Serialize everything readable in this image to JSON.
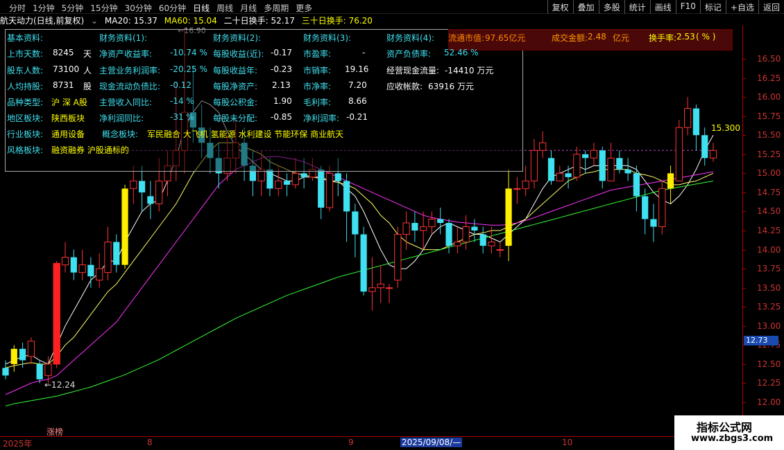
{
  "toolbar": {
    "periods": [
      "分时",
      "1分钟",
      "5分钟",
      "15分钟",
      "30分钟",
      "60分钟",
      "日线",
      "周线",
      "月线",
      "多周期",
      "更多"
    ],
    "right_tools": [
      "复权",
      "叠加",
      "多股",
      "统计",
      "画线",
      "F10",
      "标记",
      "+自选",
      "返回"
    ]
  },
  "infobar": {
    "stock": "航天动力(日线,前复权)",
    "ma20": "MA20: 15.37",
    "ma60": "MA60: 15.04",
    "turn20": "二十日换手: 52.17",
    "turn30": "三十日换手: 76.20",
    "high_note": "←16.90"
  },
  "panel": {
    "col1_header": "基本资料:",
    "col2_header": "财务资料(1):",
    "col3_header": "财务资料(2):",
    "col4_header": "财务资料(3):",
    "col5_header": "财务资料(4):",
    "r1": {
      "l1": "上市天数:",
      "v1": "8245",
      "u1": "天",
      "l2": "净资产收益率:",
      "v2": "-10.74 %",
      "l3": "每股收益(近):",
      "v3": "-0.17",
      "l4": "市盈率:",
      "v4": "-",
      "l5": "资产负债率:",
      "v5": "52.46 %"
    },
    "r2": {
      "l1": "股东人数:",
      "v1": "73100",
      "u1": "人",
      "l2": "主营业务利润率:",
      "v2": "-20.25 %",
      "l3": "每股收益年:",
      "v3": "-0.23",
      "l4": "市销率:",
      "v4": "19.16",
      "l5": "经营现金流量:",
      "v5": "-14410 万元"
    },
    "r3": {
      "l1": "人均持股:",
      "v1": "8731",
      "u1": "股",
      "l2": "现金流动负债比:",
      "v2": "-0.12",
      "l3": "每股净资产:",
      "v3": "2.13",
      "l4": "市净率:",
      "v4": "7.20",
      "l5": "应收帐款:",
      "v5": "63916 万元"
    },
    "r4": {
      "l1": "品种类型:",
      "v1": "沪 深 A股",
      "l2": "主营收入同比:",
      "v2": "-14 %",
      "l3": "每股公积金:",
      "v3": "1.90",
      "l4": "毛利率:",
      "v4": "8.66"
    },
    "r5": {
      "l1": "地区板块:",
      "v1": "陕西板块",
      "l2": "净利润同比:",
      "v2": "-31 %",
      "l3": "每股未分配:",
      "v3": "-0.85",
      "l4": "净利润率:",
      "v4": "-0.21"
    },
    "r6": {
      "l1": "行业板块:",
      "v1": "通用设备",
      "l2": "概念板块:",
      "v2": "军民融合 大飞机 氢能源 水利建设 节能环保 商业航天"
    },
    "r7": {
      "l1": "风格板块:",
      "v1": "融资融券 沪股通标的"
    }
  },
  "market": {
    "float_label": "流通市值:",
    "float_value": "97.65亿元",
    "amount_label": "成交金额:",
    "amount_value": "2.48",
    "amount_unit": "亿元",
    "turnover_label": "换手率:",
    "turnover_value": "2.53",
    "turnover_unit": "( % )"
  },
  "price_axis": {
    "ticks": [
      "16.50",
      "16.25",
      "16.00",
      "15.75",
      "15.50",
      "15.25",
      "15.00",
      "14.75",
      "14.50",
      "14.25",
      "14.00",
      "13.75",
      "13.50",
      "13.25",
      "13.00",
      "12.75",
      "12.50",
      "12.25",
      "12.00"
    ],
    "current": "12.73"
  },
  "annotations": {
    "low": "←12.24",
    "last_high": "15.300",
    "zhangbang": "涨榜"
  },
  "time_axis": {
    "year": "2025年",
    "m8": "8",
    "m9": "9",
    "date": "2025/09/08/—",
    "m10": "10"
  },
  "watermark": {
    "title": "指标公式网",
    "url": "www.zbgs3.com"
  },
  "colors": {
    "up": "#ff3333",
    "down": "#3fe0f0",
    "limit": "#ffee00",
    "ma5": "#ffffff",
    "ma10": "#ffff66",
    "ma20": "#ff33ff",
    "ma60": "#33ff33"
  },
  "chart_data": {
    "type": "candlestick",
    "ylim": [
      11.9,
      16.8
    ],
    "candles": [
      [
        12.45,
        12.35,
        12.55,
        12.3
      ],
      [
        12.5,
        12.7,
        12.75,
        12.4
      ],
      [
        12.7,
        12.55,
        12.78,
        12.45
      ],
      [
        12.6,
        12.8,
        12.85,
        12.5
      ],
      [
        12.5,
        12.3,
        12.55,
        12.25
      ],
      [
        12.35,
        12.5,
        12.6,
        12.24
      ],
      [
        12.5,
        13.82,
        13.85,
        12.45
      ],
      [
        13.8,
        13.9,
        14.1,
        13.7
      ],
      [
        13.9,
        13.7,
        14.0,
        13.6
      ],
      [
        13.7,
        13.8,
        14.0,
        13.6
      ],
      [
        13.8,
        13.65,
        13.9,
        13.5
      ],
      [
        13.6,
        13.75,
        13.95,
        13.5
      ],
      [
        13.7,
        14.1,
        14.3,
        13.6
      ],
      [
        14.1,
        13.8,
        14.2,
        13.7
      ],
      [
        13.8,
        14.8,
        14.85,
        13.75
      ],
      [
        14.8,
        14.9,
        15.1,
        14.6
      ],
      [
        14.9,
        14.75,
        15.1,
        14.5
      ],
      [
        14.7,
        14.6,
        14.9,
        14.4
      ],
      [
        14.6,
        14.9,
        15.2,
        14.5
      ],
      [
        14.9,
        15.1,
        15.3,
        14.7
      ],
      [
        15.1,
        15.3,
        16.2,
        14.9
      ],
      [
        15.3,
        15.8,
        16.9,
        15.0
      ],
      [
        15.8,
        15.6,
        16.4,
        15.4
      ],
      [
        15.6,
        15.4,
        15.9,
        15.2
      ],
      [
        15.4,
        15.2,
        15.6,
        15.0
      ],
      [
        15.2,
        15.0,
        15.4,
        14.8
      ],
      [
        15.0,
        15.2,
        15.5,
        14.9
      ],
      [
        15.2,
        15.4,
        15.7,
        15.0
      ],
      [
        15.4,
        15.1,
        15.6,
        14.9
      ],
      [
        15.1,
        14.9,
        15.3,
        14.7
      ],
      [
        14.9,
        15.05,
        15.3,
        14.7
      ],
      [
        15.05,
        14.8,
        15.2,
        14.7
      ],
      [
        14.8,
        14.9,
        15.1,
        14.7
      ],
      [
        14.9,
        14.85,
        15.0,
        14.7
      ],
      [
        14.85,
        15.0,
        15.2,
        14.8
      ],
      [
        15.0,
        14.95,
        15.2,
        14.8
      ],
      [
        14.95,
        15.05,
        15.2,
        14.9
      ],
      [
        15.05,
        14.55,
        15.1,
        14.4
      ],
      [
        14.55,
        15.0,
        15.1,
        14.5
      ],
      [
        15.0,
        14.9,
        15.2,
        14.7
      ],
      [
        14.9,
        14.5,
        15.0,
        14.1
      ],
      [
        14.5,
        14.2,
        14.6,
        13.9
      ],
      [
        14.2,
        13.45,
        14.3,
        13.4
      ],
      [
        13.45,
        13.5,
        13.9,
        13.2
      ],
      [
        13.5,
        13.55,
        13.8,
        13.3
      ],
      [
        13.5,
        13.5,
        13.55,
        13.3
      ],
      [
        13.6,
        14.2,
        14.3,
        13.5
      ],
      [
        14.2,
        14.35,
        14.5,
        14.0
      ],
      [
        14.35,
        14.25,
        14.5,
        14.1
      ],
      [
        14.25,
        14.3,
        14.5,
        14.0
      ],
      [
        14.3,
        14.4,
        14.5,
        14.2
      ],
      [
        14.4,
        14.35,
        14.55,
        14.2
      ],
      [
        14.35,
        14.05,
        14.4,
        13.95
      ],
      [
        14.05,
        14.1,
        14.3,
        13.95
      ],
      [
        14.1,
        14.3,
        14.45,
        14.0
      ],
      [
        14.3,
        14.25,
        14.4,
        14.1
      ],
      [
        14.2,
        14.05,
        14.3,
        13.95
      ],
      [
        14.05,
        14.1,
        14.3,
        13.95
      ],
      [
        14.0,
        14.0,
        14.1,
        13.9
      ],
      [
        14.05,
        14.8,
        15.05,
        13.85
      ],
      [
        14.8,
        14.8,
        14.95,
        14.6
      ],
      [
        14.8,
        14.9,
        15.1,
        14.7
      ],
      [
        14.9,
        15.3,
        15.45,
        14.8
      ],
      [
        15.3,
        15.4,
        15.55,
        15.2
      ],
      [
        15.2,
        14.9,
        15.3,
        14.85
      ],
      [
        14.9,
        15.0,
        15.1,
        14.9
      ],
      [
        15.0,
        14.95,
        15.1,
        14.8
      ],
      [
        14.95,
        15.25,
        15.35,
        14.9
      ],
      [
        15.25,
        15.2,
        15.3,
        15.0
      ],
      [
        15.2,
        15.3,
        15.4,
        15.1
      ],
      [
        15.3,
        14.9,
        15.35,
        14.8
      ],
      [
        14.9,
        15.2,
        15.4,
        14.9
      ],
      [
        15.2,
        15.05,
        15.3,
        15.0
      ],
      [
        15.05,
        15.0,
        15.2,
        14.9
      ],
      [
        15.0,
        14.7,
        15.1,
        14.5
      ],
      [
        14.7,
        14.4,
        14.8,
        14.2
      ],
      [
        14.4,
        14.3,
        14.6,
        14.1
      ],
      [
        14.3,
        14.8,
        14.9,
        14.2
      ],
      [
        14.8,
        15.0,
        15.1,
        14.6
      ],
      [
        14.9,
        15.6,
        15.7,
        14.9
      ],
      [
        15.6,
        15.85,
        16.0,
        15.5
      ],
      [
        15.85,
        15.5,
        15.9,
        15.3
      ],
      [
        15.5,
        15.2,
        15.6,
        15.1
      ],
      [
        15.2,
        15.3,
        15.4,
        15.15
      ]
    ],
    "limit_up_indices": [
      1,
      14,
      59,
      78
    ],
    "ma_series": [
      {
        "name": "MA5",
        "values": [
          12.5,
          12.55,
          12.6,
          12.62,
          12.55,
          12.5,
          12.75,
          13.0,
          13.2,
          13.4,
          13.6,
          13.7,
          13.85,
          13.85,
          14.1,
          14.3,
          14.5,
          14.6,
          14.65,
          14.9,
          15.2,
          15.6,
          15.8,
          15.95,
          15.9,
          15.8,
          15.55,
          15.35,
          15.25,
          15.15,
          15.05,
          15.0,
          14.95,
          14.9,
          14.9,
          14.95,
          14.95,
          14.95,
          14.9,
          14.9,
          14.8,
          14.7,
          14.5,
          14.25,
          14.0,
          13.8,
          13.75,
          13.75,
          13.85,
          14.0,
          14.2,
          14.3,
          14.35,
          14.3,
          14.25,
          14.2,
          14.2,
          14.15,
          14.1,
          14.2,
          14.3,
          14.4,
          14.6,
          14.8,
          14.95,
          15.0,
          15.05,
          15.1,
          15.05,
          15.1,
          15.1,
          15.1,
          15.1,
          15.1,
          15.05,
          14.9,
          14.75,
          14.65,
          14.6,
          14.7,
          14.85,
          15.05,
          15.3,
          15.5
        ]
      },
      {
        "name": "MA10",
        "values": [
          12.45,
          12.48,
          12.5,
          12.52,
          12.5,
          12.5,
          12.6,
          12.75,
          12.85,
          13.0,
          13.15,
          13.3,
          13.45,
          13.55,
          13.7,
          13.85,
          14.0,
          14.15,
          14.3,
          14.45,
          14.6,
          14.8,
          15.0,
          15.15,
          15.3,
          15.4,
          15.4,
          15.4,
          15.35,
          15.3,
          15.25,
          15.15,
          15.1,
          15.05,
          15.0,
          14.98,
          14.95,
          14.93,
          14.9,
          14.88,
          14.85,
          14.8,
          14.7,
          14.6,
          14.45,
          14.35,
          14.2,
          14.1,
          14.05,
          14.0,
          14.0,
          14.0,
          14.05,
          14.1,
          14.15,
          14.2,
          14.22,
          14.25,
          14.25,
          14.3,
          14.35,
          14.4,
          14.5,
          14.6,
          14.7,
          14.8,
          14.9,
          14.95,
          15.0,
          15.02,
          15.05,
          15.05,
          15.05,
          15.05,
          15.0,
          14.98,
          14.95,
          14.9,
          14.85,
          14.85,
          14.88,
          14.9,
          14.95,
          15.0
        ]
      },
      {
        "name": "MA20",
        "values": [
          12.1,
          12.15,
          12.2,
          12.25,
          12.28,
          12.3,
          12.35,
          12.45,
          12.55,
          12.65,
          12.75,
          12.85,
          12.95,
          13.05,
          13.2,
          13.35,
          13.5,
          13.65,
          13.8,
          13.95,
          14.1,
          14.25,
          14.4,
          14.55,
          14.7,
          14.85,
          14.95,
          15.05,
          15.1,
          15.15,
          15.2,
          15.22,
          15.22,
          15.2,
          15.18,
          15.15,
          15.1,
          15.05,
          15.0,
          14.95,
          14.9,
          14.85,
          14.8,
          14.75,
          14.7,
          14.65,
          14.6,
          14.55,
          14.5,
          14.45,
          14.42,
          14.4,
          14.38,
          14.36,
          14.35,
          14.34,
          14.33,
          14.32,
          14.32,
          14.33,
          14.35,
          14.38,
          14.42,
          14.46,
          14.5,
          14.54,
          14.58,
          14.62,
          14.66,
          14.7,
          14.74,
          14.78,
          14.8,
          14.82,
          14.84,
          14.86,
          14.88,
          14.9,
          14.92,
          14.94,
          14.96,
          14.98,
          15.0,
          15.02
        ]
      },
      {
        "name": "MA60",
        "values": [
          11.95,
          11.98,
          12.0,
          12.02,
          12.04,
          12.06,
          12.08,
          12.11,
          12.14,
          12.17,
          12.2,
          12.24,
          12.28,
          12.32,
          12.36,
          12.41,
          12.46,
          12.51,
          12.56,
          12.62,
          12.68,
          12.74,
          12.8,
          12.86,
          12.92,
          12.98,
          13.04,
          13.1,
          13.15,
          13.2,
          13.25,
          13.3,
          13.35,
          13.4,
          13.44,
          13.48,
          13.52,
          13.56,
          13.6,
          13.64,
          13.67,
          13.7,
          13.73,
          13.76,
          13.79,
          13.82,
          13.85,
          13.88,
          13.91,
          13.94,
          13.97,
          14.0,
          14.03,
          14.06,
          14.09,
          14.12,
          14.15,
          14.18,
          14.21,
          14.24,
          14.27,
          14.3,
          14.33,
          14.36,
          14.39,
          14.42,
          14.45,
          14.48,
          14.51,
          14.54,
          14.57,
          14.6,
          14.63,
          14.66,
          14.69,
          14.72,
          14.75,
          14.78,
          14.8,
          14.82,
          14.84,
          14.86,
          14.88,
          14.9
        ]
      }
    ]
  }
}
